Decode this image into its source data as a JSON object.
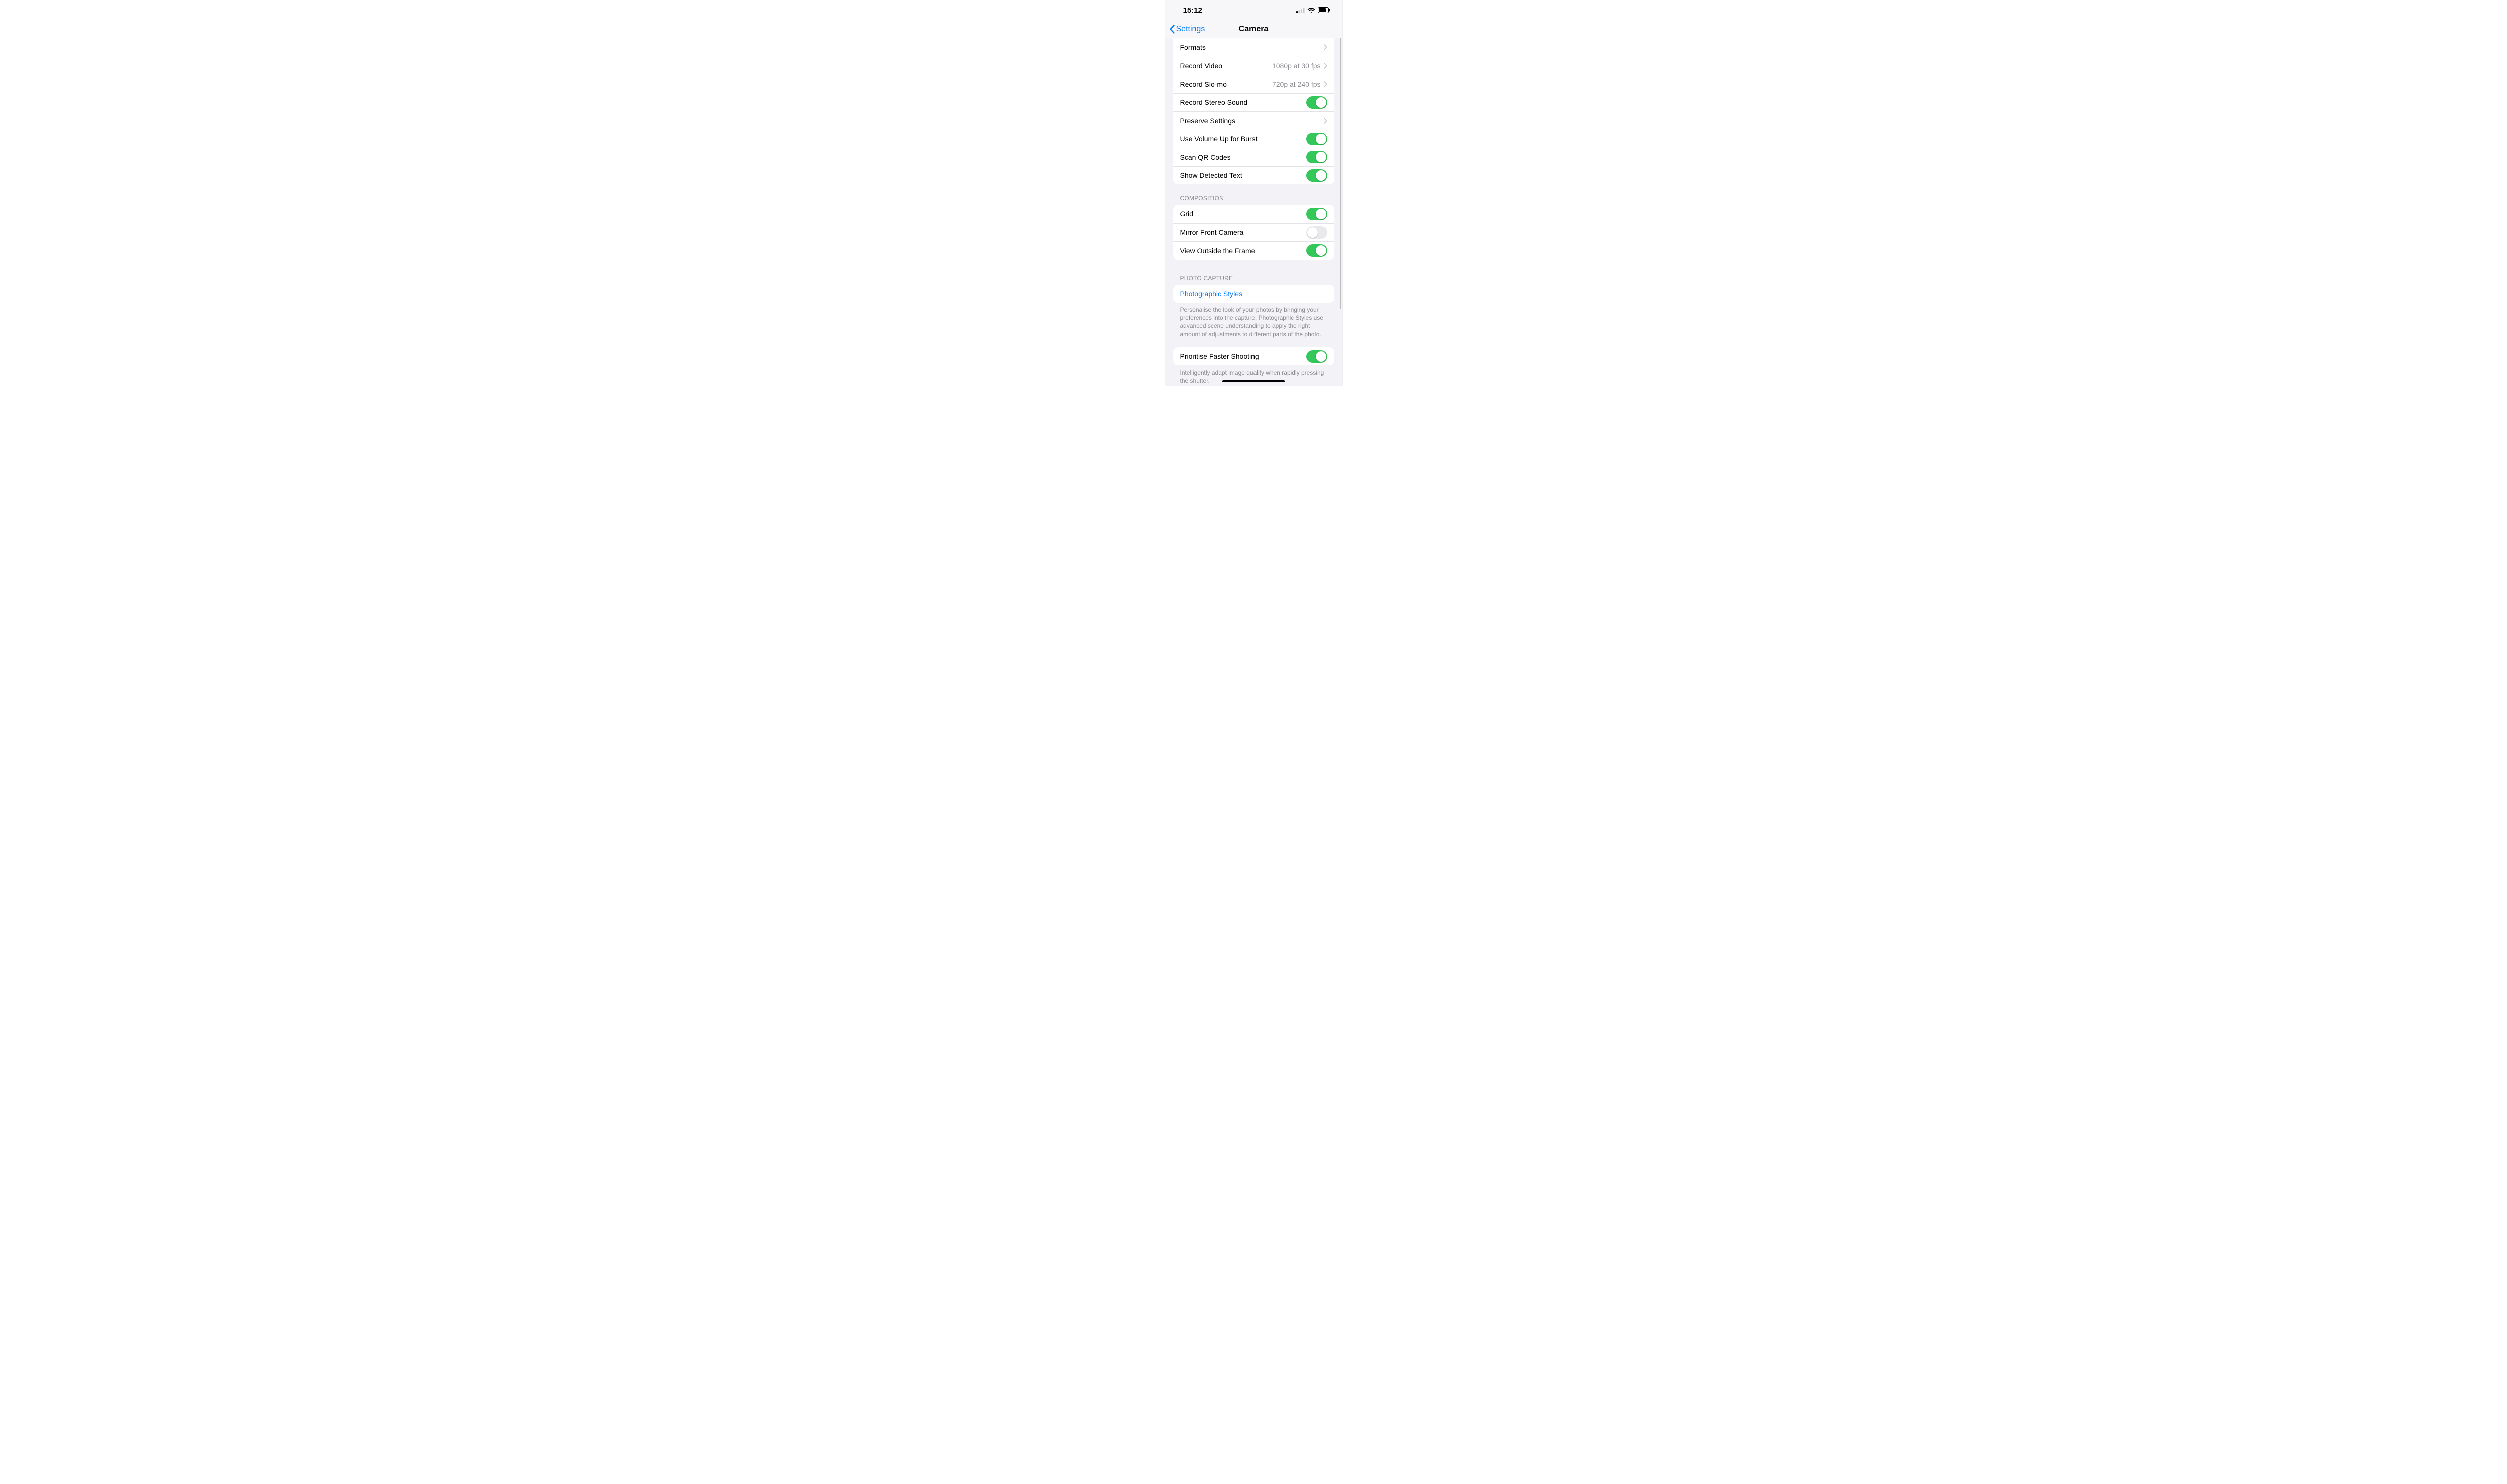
{
  "status": {
    "time": "15:12"
  },
  "nav": {
    "back_label": "Settings",
    "title": "Camera"
  },
  "section1": {
    "formats": "Formats",
    "record_video": "Record Video",
    "record_video_val": "1080p at 30 fps",
    "record_slomo": "Record Slo-mo",
    "record_slomo_val": "720p at 240 fps",
    "stereo_sound": "Record Stereo Sound",
    "preserve": "Preserve Settings",
    "volume_burst": "Use Volume Up for Burst",
    "scan_qr": "Scan QR Codes",
    "detected_text": "Show Detected Text"
  },
  "section2": {
    "header": "Composition",
    "grid": "Grid",
    "mirror": "Mirror Front Camera",
    "view_outside": "View Outside the Frame"
  },
  "section3": {
    "header": "Photo Capture",
    "photo_styles": "Photographic Styles",
    "footer": "Personalise the look of your photos by bringing your preferences into the capture. Photographic Styles use advanced scene understanding to apply the right amount of adjustments to different parts of the photo."
  },
  "section4": {
    "prioritise": "Prioritise Faster Shooting",
    "footer": "Intelligently adapt image quality when rapidly pressing the shutter."
  },
  "toggles": {
    "stereo_sound": true,
    "volume_burst": true,
    "scan_qr": true,
    "detected_text": true,
    "grid": true,
    "mirror": false,
    "view_outside": true,
    "prioritise": true,
    "lens": true
  }
}
